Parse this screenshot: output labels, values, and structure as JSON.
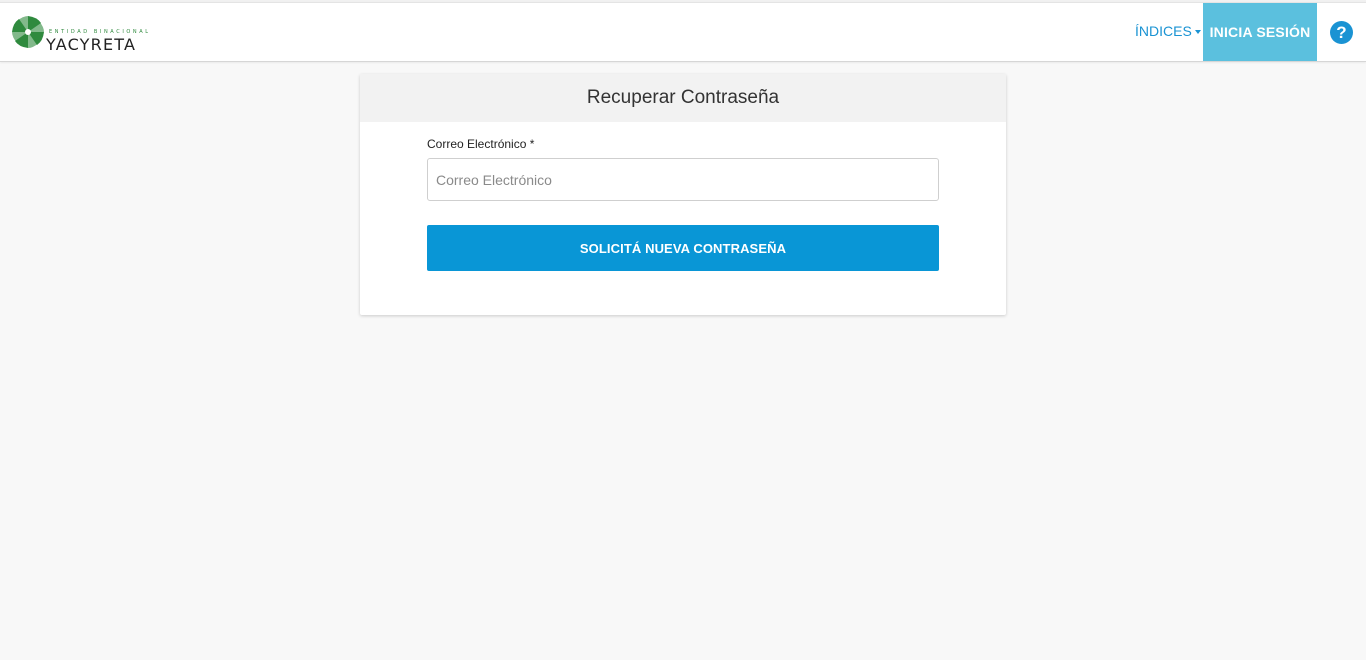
{
  "header": {
    "logo": {
      "subtitle": "ENTIDAD BINACIONAL",
      "name": "YACYRETA"
    },
    "nav": {
      "indices_label": "ÍNDICES",
      "login_label": "INICIA SESIÓN",
      "help_icon": "question-circle-icon"
    }
  },
  "card": {
    "title": "Recuperar Contraseña",
    "email": {
      "label": "Correo Electrónico *",
      "placeholder": "Correo Electrónico",
      "value": ""
    },
    "submit_label": "SOLICITÁ NUEVA CONTRASEÑA"
  },
  "colors": {
    "primary": "#0996d6",
    "login_bg": "#5bc0de",
    "link": "#1a93d3",
    "logo_green": "#2f8a3e"
  }
}
